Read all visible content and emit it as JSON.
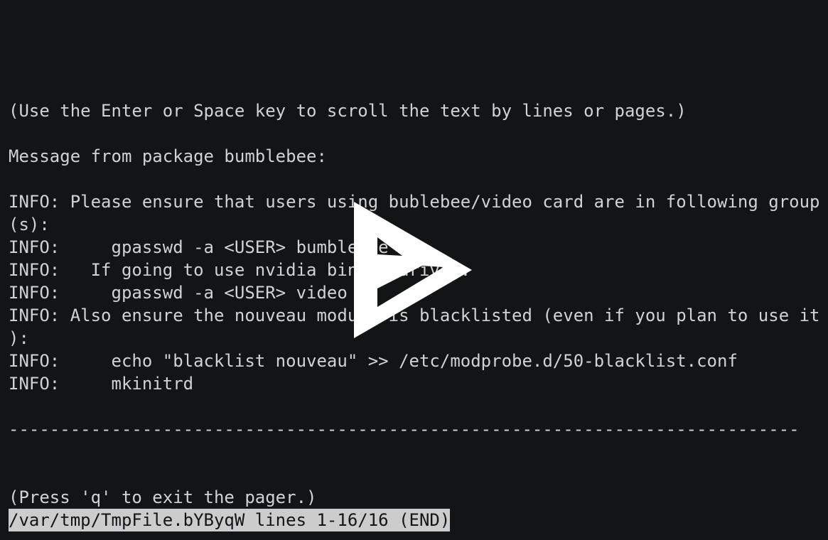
{
  "terminal": {
    "lines": [
      "(Use the Enter or Space key to scroll the text by lines or pages.)",
      "",
      "Message from package bumblebee:",
      "",
      "INFO: Please ensure that users using bublebee/video card are in following group",
      "(s):",
      "INFO:     gpasswd -a <USER> bumblebee",
      "INFO:   If going to use nvidia binary driver:",
      "INFO:     gpasswd -a <USER> video",
      "INFO: Also ensure the nouveau module is blacklisted (even if you plan to use it",
      "):",
      "INFO:     echo \"blacklist nouveau\" >> /etc/modprobe.d/50-blacklist.conf",
      "INFO:     mkinitrd",
      "",
      "-----------------------------------------------------------------------------",
      "",
      "",
      "(Press 'q' to exit the pager.)"
    ],
    "status_bar": "/var/tmp/TmpFile.bYByqW lines 1-16/16 (END)"
  },
  "overlay": {
    "icon": "play-icon",
    "color": "#ffffff"
  },
  "colors": {
    "background": "#131416",
    "text": "#d2d2d2",
    "status_background": "#cccccc"
  }
}
